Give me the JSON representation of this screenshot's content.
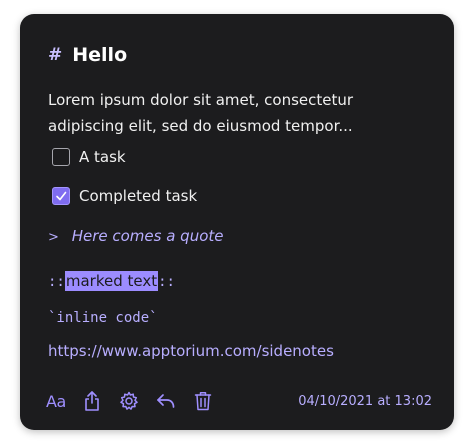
{
  "note": {
    "heading_marker": "#",
    "title": "Hello",
    "paragraph": "Lorem ipsum dolor sit amet, consectetur adipiscing elit, sed do eiusmod tempor...",
    "tasks": [
      {
        "label": "A task",
        "checked": false
      },
      {
        "label": "Completed task",
        "checked": true
      }
    ],
    "quote_marker": ">",
    "quote": "Here comes a quote",
    "marked_prefix": "::",
    "marked_text": "marked text",
    "marked_suffix": "::",
    "inline_code": "`inline code`",
    "link": "https://www.apptorium.com/sidenotes"
  },
  "toolbar": {
    "font_label": "Aa",
    "icons": [
      "font-icon",
      "share-icon",
      "gear-icon",
      "undo-icon",
      "trash-icon"
    ],
    "date": "04/10/2021 at 13:02"
  },
  "colors": {
    "background": "#1c1c1e",
    "accent": "#9f8fff",
    "text": "#f0f0f0"
  }
}
